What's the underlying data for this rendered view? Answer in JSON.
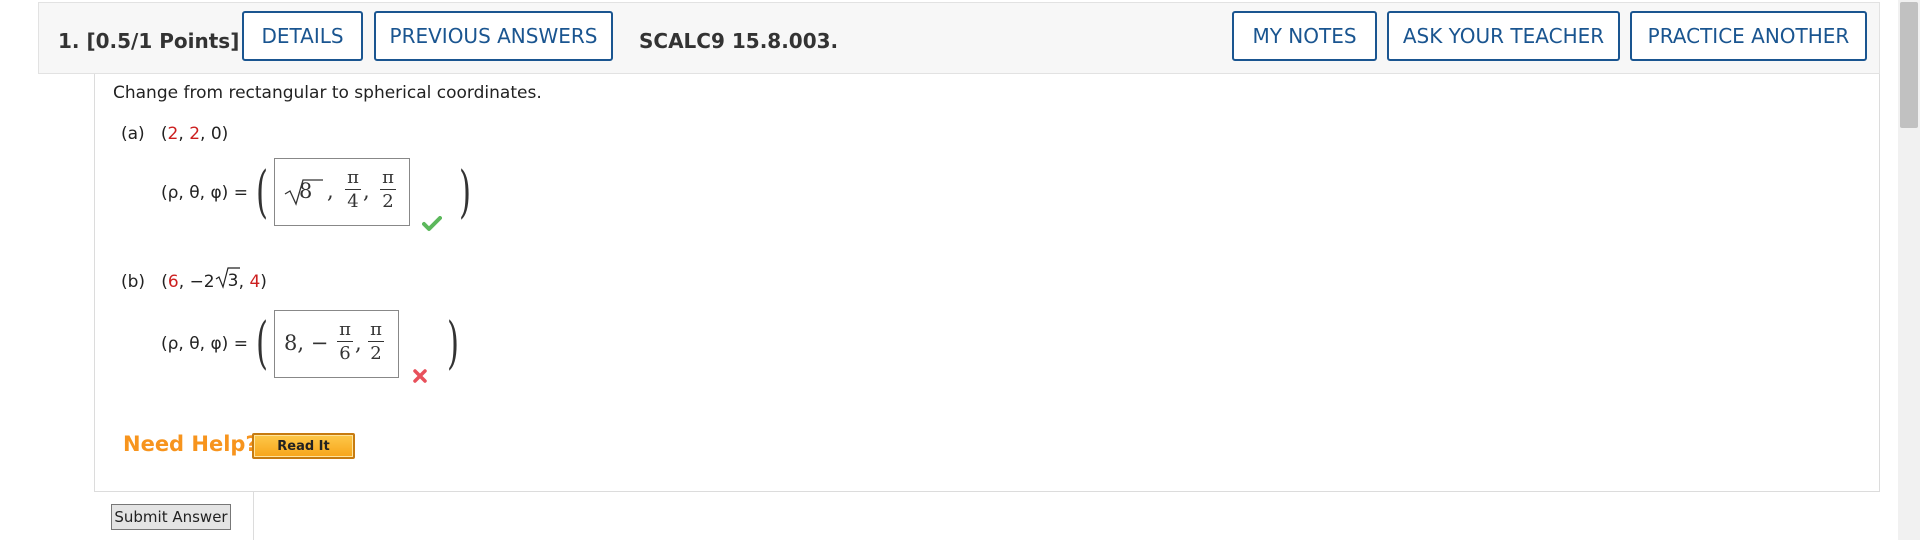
{
  "question": {
    "number_points": "1.  [0.5/1 Points]",
    "reference": "SCALC9 15.8.003."
  },
  "header_buttons": {
    "details": "DETAILS",
    "previous_answers": "PREVIOUS ANSWERS",
    "my_notes": "MY NOTES",
    "ask_teacher": "ASK YOUR TEACHER",
    "practice_another": "PRACTICE ANOTHER"
  },
  "instruction": "Change from rectangular to spherical coordinates.",
  "parts": [
    {
      "label": "(a)",
      "point_open": "(",
      "point_values": [
        "2",
        "2",
        "0"
      ],
      "point_close": ")",
      "lhs": "(ρ, θ, φ) =",
      "answer": {
        "radical": "8",
        "theta_num": "π",
        "theta_den": "4",
        "phi_num": "π",
        "phi_den": "2"
      },
      "status": "correct"
    },
    {
      "label": "(b)",
      "point_open": "(",
      "point_x": "6",
      "point_y_prefix": "−2",
      "point_y_radical": "3",
      "point_z": "4",
      "point_close": ")",
      "lhs": "(ρ, θ, φ) =",
      "answer": {
        "rho": "8, −",
        "theta_num": "π",
        "theta_den": "6",
        "phi_num": "π",
        "phi_den": "2"
      },
      "status": "incorrect"
    }
  ],
  "help": {
    "label": "Need Help?",
    "read_it": "Read It"
  },
  "submit": "Submit Answer",
  "icons": {
    "correct": "check-icon",
    "incorrect": "x-icon"
  },
  "colors": {
    "accent": "#1a5590",
    "help": "#f7941d",
    "correct": "#5cb85c",
    "incorrect": "#e8505b",
    "point_value": "#cc1f1f"
  }
}
